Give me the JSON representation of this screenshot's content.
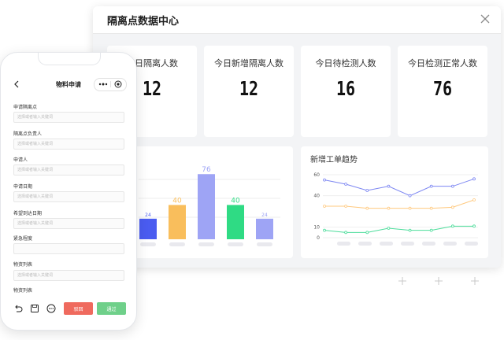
{
  "dashboard": {
    "title": "隔离点数据中心",
    "stats": [
      {
        "label": "今日隔离人数",
        "value": "12"
      },
      {
        "label": "今日新增隔离人数",
        "value": "12"
      },
      {
        "label": "今日待检测人数",
        "value": "16"
      },
      {
        "label": "今日检测正常人数",
        "value": "76"
      }
    ],
    "bar_chart": {
      "type": "bar",
      "values": [
        24,
        40,
        76,
        40,
        24
      ],
      "colors": [
        "#4a5cf0",
        "#f9be5c",
        "#9ea4f5",
        "#2fdb84",
        "#9ea4f5"
      ],
      "ylim": [
        0,
        90
      ]
    },
    "line_chart": {
      "type": "line",
      "title": "新增工单趋势",
      "y_ticks": [
        "60",
        "40",
        "10",
        "0"
      ],
      "ylim": [
        0,
        60
      ],
      "series": [
        {
          "values": [
            55,
            51,
            45,
            49,
            40,
            49,
            49,
            56
          ],
          "color": "#7c86f2"
        },
        {
          "values": [
            30,
            30,
            28,
            28,
            28,
            28,
            29,
            36
          ],
          "color": "#ffc97f"
        },
        {
          "values": [
            7,
            5,
            5,
            9,
            7,
            7,
            11,
            11
          ],
          "color": "#4cdd9b"
        }
      ]
    }
  },
  "phone": {
    "title": "物料申请",
    "fields": [
      {
        "label": "申请隔离点",
        "placeholder": "选择或者输入关键词"
      },
      {
        "label": "隔离点负责人",
        "placeholder": "选择或者输入关键词"
      },
      {
        "label": "申请人",
        "placeholder": "选择或者输入关键词"
      },
      {
        "label": "申请日期",
        "placeholder": "选择或者输入关键词"
      },
      {
        "label": "希望到达日期",
        "placeholder": "选择或者输入关键词"
      },
      {
        "label": "紧急程度",
        "placeholder": ""
      },
      {
        "label": "物资列表",
        "placeholder": "选择或者输入关键词"
      },
      {
        "label": "物资列表",
        "placeholder": ""
      }
    ],
    "reject_label": "驳回",
    "approve_label": "通过",
    "reject_color": "#ef6a5e",
    "approve_color": "#6fd08a"
  },
  "icons": [
    "close-icon",
    "back-icon",
    "more-icon",
    "target-icon",
    "undo-icon",
    "save-icon",
    "more-circle-icon",
    "plus-icon"
  ]
}
